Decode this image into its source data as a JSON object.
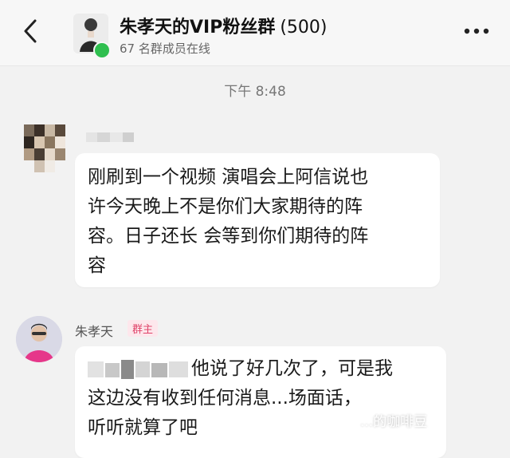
{
  "header": {
    "title": "朱孝天的VIP粉丝群",
    "count": "(500)",
    "members_online": "67 名群成员在线",
    "back_icon": "chevron-left-icon",
    "more_icon": "more-horizontal-icon"
  },
  "chat": {
    "timestamp": "下午 8:48",
    "messages": [
      {
        "sender": "",
        "lines": [
          "刚刷到一个视频 演唱会上阿信说也",
          "许今天晚上不是你们大家期待的阵",
          "容。日子还长 会等到你们期待的阵",
          "容"
        ]
      },
      {
        "sender": "朱孝天",
        "badge": "群主",
        "lines": [
          "他说了好几次了，可是我",
          "这边没有收到任何消息...场面话，",
          "听听就算了吧"
        ]
      }
    ]
  },
  "watermark": "...的咖啡豆",
  "colors": {
    "online": "#2fbf4f",
    "badge_text": "#e0446a",
    "badge_bg": "#fde7ec",
    "bubble": "#ffffff",
    "background": "#f2f2f2"
  }
}
